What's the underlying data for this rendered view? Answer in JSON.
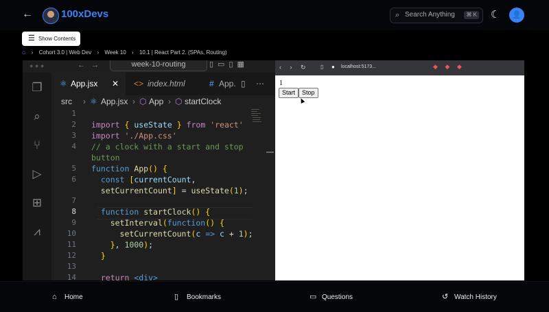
{
  "header": {
    "brand": "100xDevs",
    "search_placeholder": "Search Anything",
    "search_shortcut": "⌘ K"
  },
  "controls": {
    "show_contents": "Show Contents"
  },
  "breadcrumbs": [
    "Cohort 3.0 | Web Dev",
    "Week 10",
    "10.1 | React Part 2. (SPAs, Routing)"
  ],
  "editor": {
    "title_search": "week-10-routing",
    "tabs": [
      "App.jsx",
      "index.html",
      "App."
    ],
    "breadcrumb": [
      "src",
      "App.jsx",
      "App",
      "startClock"
    ],
    "line_numbers": [
      "1",
      "2",
      "3",
      "4",
      "",
      "5",
      "6",
      "",
      "7",
      "8",
      "9",
      "10",
      "11",
      "12",
      "13",
      "14"
    ],
    "current_line": "8"
  },
  "browser": {
    "url": "localhost:5173...",
    "count": "1",
    "start_label": "Start",
    "stop_label": "Stop"
  },
  "bottom_nav": [
    "Home",
    "Bookmarks",
    "Questions",
    "Watch History"
  ],
  "colors": {
    "accent": "#3b82f6",
    "bg": "#000000"
  }
}
